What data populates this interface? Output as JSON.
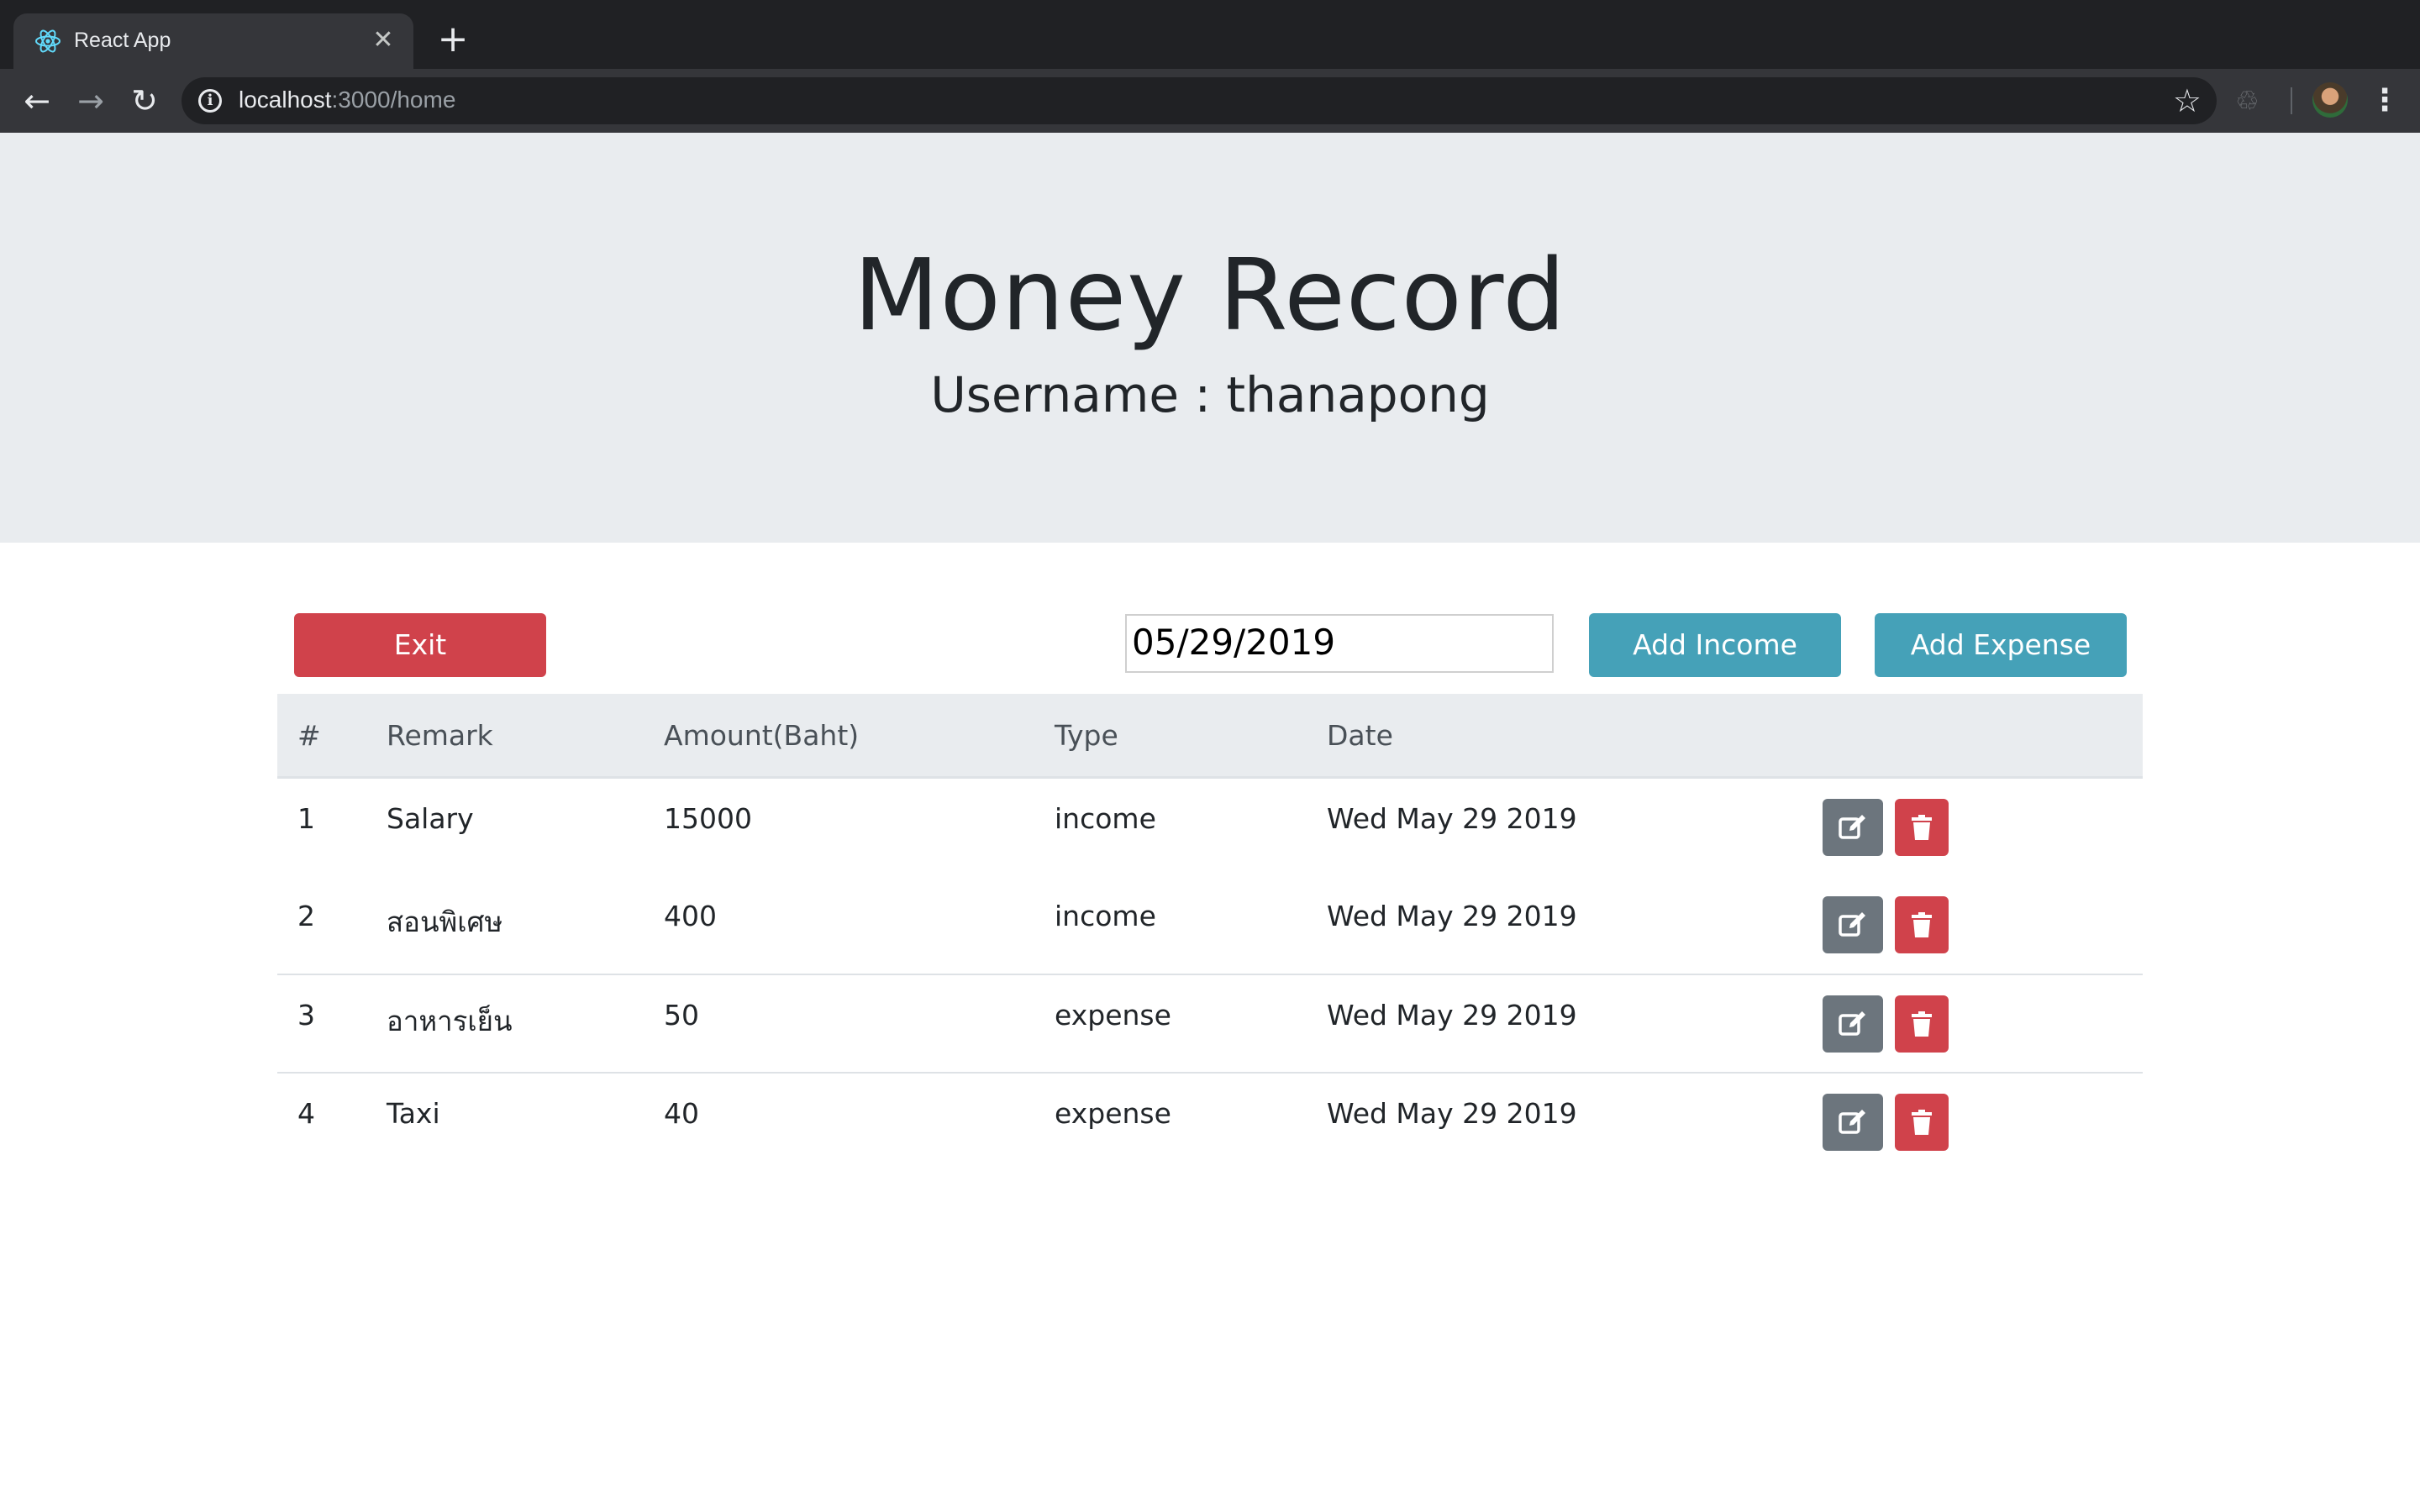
{
  "browser": {
    "tab_title": "React App",
    "url_host": "localhost",
    "url_rest": ":3000/home"
  },
  "header": {
    "title": "Money Record",
    "username_label": "Username : thanapong"
  },
  "controls": {
    "exit_label": "Exit",
    "date_value": "05/29/2019",
    "add_income_label": "Add Income",
    "add_expense_label": "Add Expense"
  },
  "table": {
    "columns": [
      "#",
      "Remark",
      "Amount(Baht)",
      "Type",
      "Date"
    ],
    "rows": [
      {
        "no": "1",
        "remark": "Salary",
        "amount": "15000",
        "type": "income",
        "date": "Wed May 29 2019"
      },
      {
        "no": "2",
        "remark": "สอนพิเศษ",
        "amount": "400",
        "type": "income",
        "date": "Wed May 29 2019"
      },
      {
        "no": "3",
        "remark": "อาหารเย็น",
        "amount": "50",
        "type": "expense",
        "date": "Wed May 29 2019"
      },
      {
        "no": "4",
        "remark": "Taxi",
        "amount": "40",
        "type": "expense",
        "date": "Wed May 29 2019"
      }
    ]
  },
  "colors": {
    "danger": "#d0424b",
    "info": "#45a1b8",
    "secondary": "#6c757d",
    "jumbotron": "#e9ecef"
  },
  "icons": {
    "edit": "pencil-square-icon",
    "delete": "trash-icon"
  }
}
